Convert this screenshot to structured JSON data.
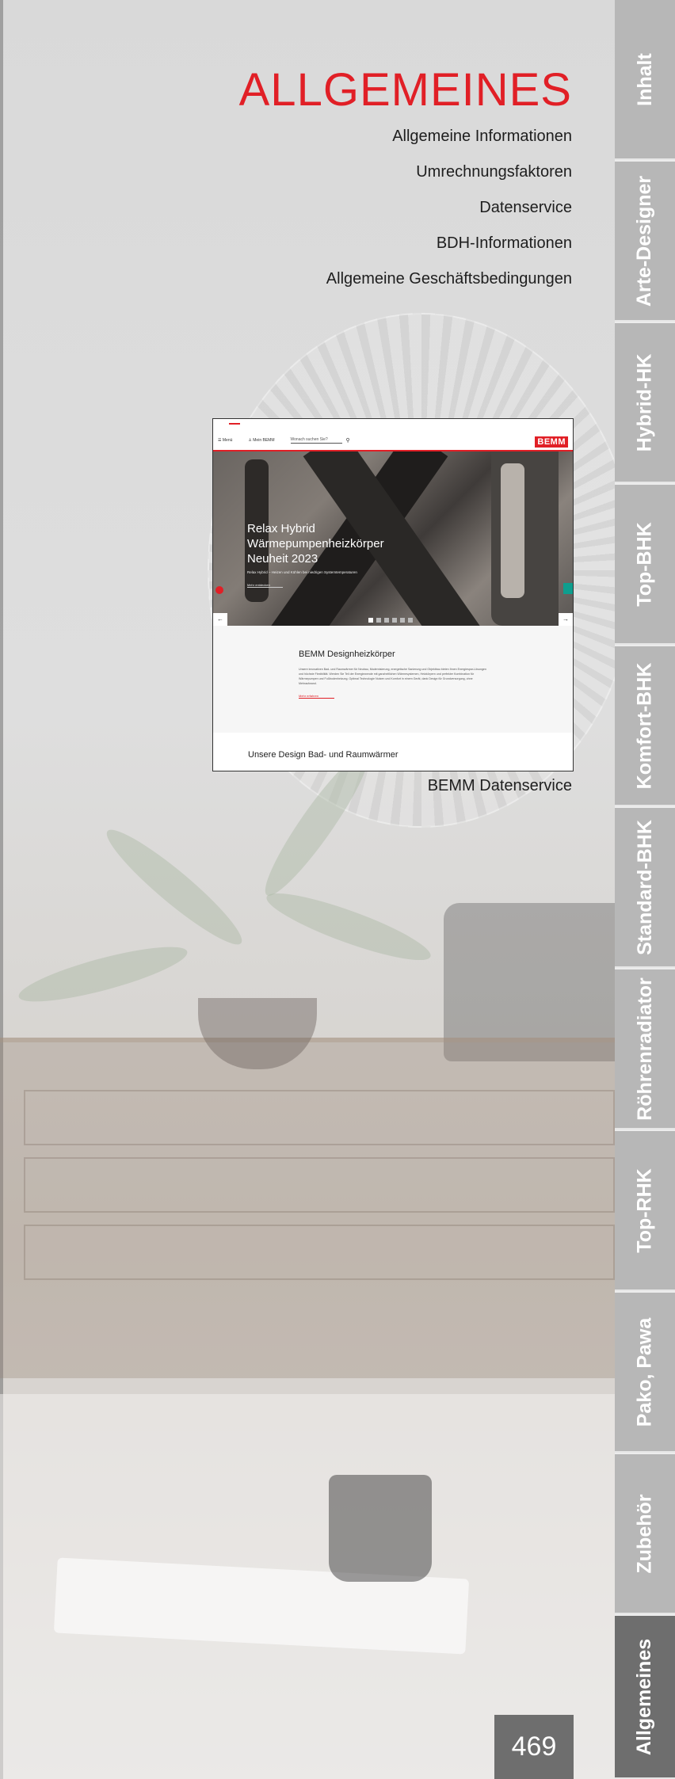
{
  "title": "ALLGEMEINES",
  "toc": [
    "Allgemeine Informationen",
    "Umrechnungsfaktoren",
    "Datenservice",
    "BDH-Informationen",
    "Allgemeine Geschäftsbedingungen"
  ],
  "screenshot": {
    "nav": {
      "menu": "☰ Menü",
      "account": "♙ Mein BEMM",
      "search": "Wonach suchen Sie?",
      "logo": "BEMM"
    },
    "hero": {
      "line1": "Relax Hybrid",
      "line2": "Wärmepumpenheizkörper",
      "line3": "Neuheit 2023",
      "sub": "Relax Hybrid – Heizen und Kühlen bei niedrigen Systemtemperaturen",
      "more": "Mehr entdecken"
    },
    "section": {
      "heading": "BEMM Designheizkörper",
      "body": "Unsere innovativen Bad- und Raumwärmer für Neubau, Modernisierung, energetische Sanierung und Objektbau bieten Ihnen Energiespar-Lösungen und höchste Flexibilität. Werden Sie Teil der Energiewende mit ganzheitlichen Wärmesystemen, Heizkörpern und perfekter Kombination für Wärmepumpen und Fußbodenheizung. Optimal Technologie Nutzen und Komfort in einem Gerät, dank Design für Grundversorgung, ohne Mehraufwand.",
      "link": "Mehr erfahren"
    },
    "footer_heading": "Unsere Design Bad- und Raumwärmer"
  },
  "caption": "BEMM Datenservice",
  "tabs": [
    "Inhalt",
    "Arte-Designer",
    "Hybrid-HK",
    "Top-BHK",
    "Komfort-BHK",
    "Standard-BHK",
    "Röhrenradiator",
    "Top-RHK",
    "Pako, Pawa",
    "Zubehör",
    "Allgemeines"
  ],
  "active_tab": "Allgemeines",
  "page_number": "469",
  "colors": {
    "accent": "#e11f26",
    "tab": "#b7b7b7",
    "tab_active": "#6e6e6e"
  }
}
